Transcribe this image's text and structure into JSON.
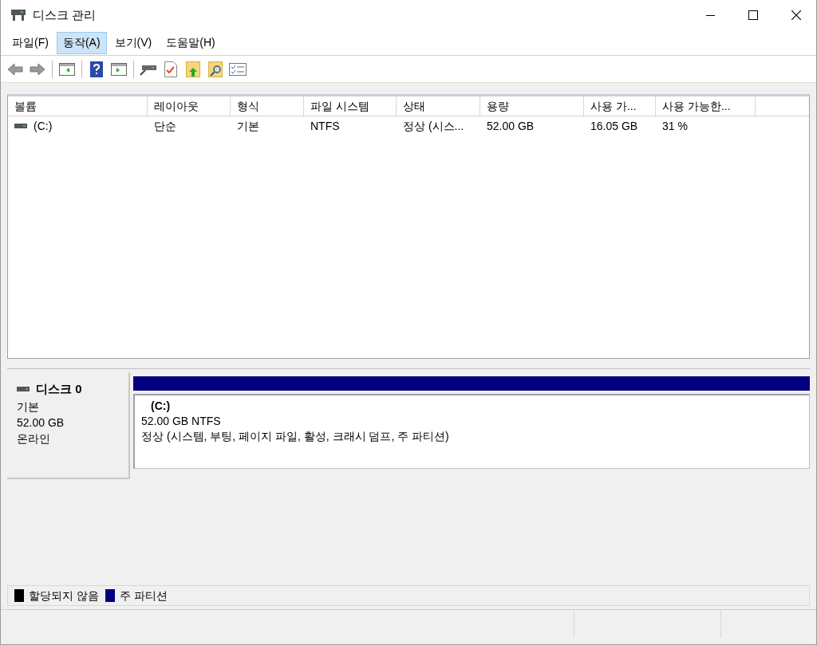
{
  "window": {
    "title": "디스크 관리"
  },
  "menu": [
    {
      "label": "파일(F)",
      "selected": false
    },
    {
      "label": "동작(A)",
      "selected": true
    },
    {
      "label": "보기(V)",
      "selected": false
    },
    {
      "label": "도움말(H)",
      "selected": false
    }
  ],
  "volume_table": {
    "columns": [
      "볼륨",
      "레이아웃",
      "형식",
      "파일 시스템",
      "상태",
      "용량",
      "사용 가...",
      "사용 가능한..."
    ],
    "rows": [
      [
        "(C:)",
        "단순",
        "기본",
        "NTFS",
        "정상 (시스...",
        "52.00 GB",
        "16.05 GB",
        "31 %"
      ]
    ]
  },
  "disk": {
    "name": "디스크 0",
    "type": "기본",
    "size": "52.00 GB",
    "status": "온라인",
    "partitions": [
      {
        "label": "(C:)",
        "size_fs": "52.00 GB NTFS",
        "status": "정상 (시스템, 부팅, 페이지 파일, 활성, 크래시 덤프, 주 파티션)",
        "color": "#000080"
      }
    ]
  },
  "legend": [
    {
      "label": "할당되지 않음",
      "color": "#000000"
    },
    {
      "label": "주 파티션",
      "color": "#000080"
    }
  ]
}
